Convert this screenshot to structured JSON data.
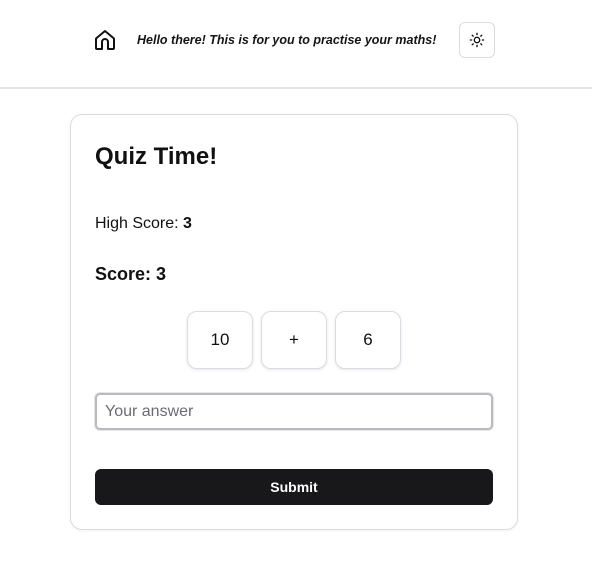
{
  "header": {
    "home_icon": "home-icon",
    "greeting": "Hello there! This is for you to practise your maths!",
    "theme_icon": "sun-icon"
  },
  "quiz": {
    "title": "Quiz Time!",
    "high_score_label": "High Score:",
    "high_score_value": "3",
    "score_text": "Score: 3",
    "problem": {
      "left_operand": "10",
      "operator": "+",
      "right_operand": "6"
    },
    "answer_value": "",
    "answer_placeholder": "Your answer",
    "submit_label": "Submit"
  },
  "colors": {
    "button_bg": "#18181b",
    "border": "#dcdce0",
    "text": "#111111"
  }
}
